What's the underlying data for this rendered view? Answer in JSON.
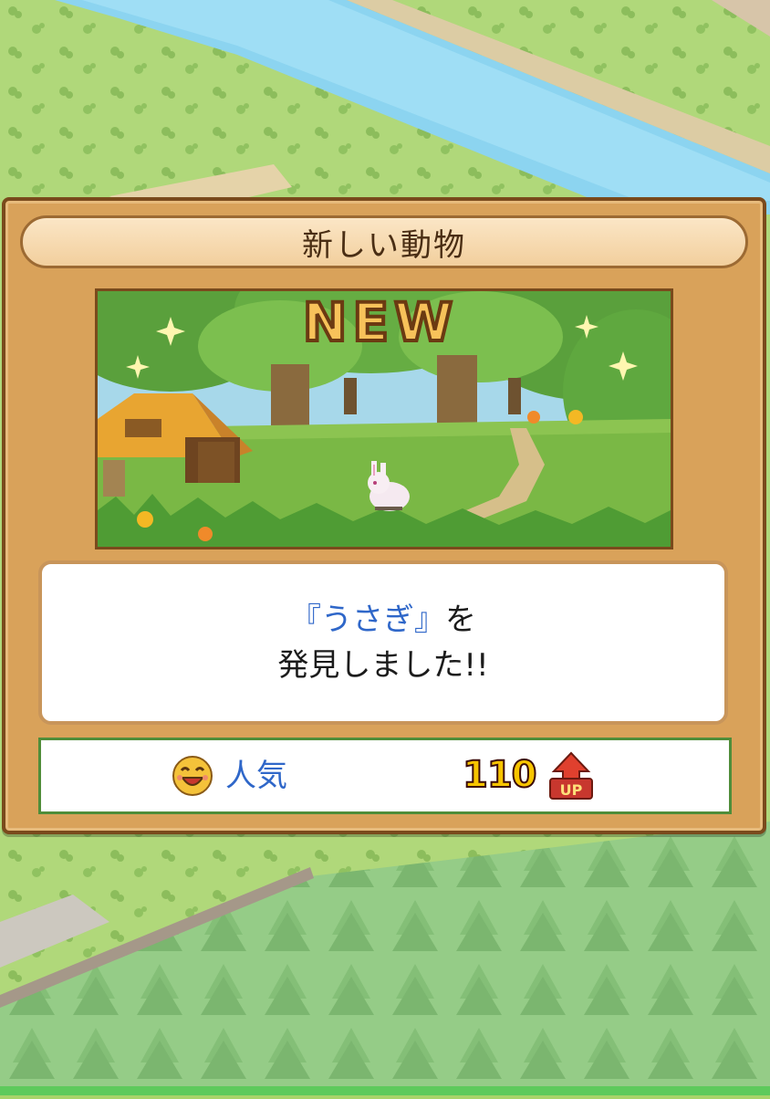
{
  "dialog": {
    "title": "新しい動物",
    "banner_text": "NEW",
    "message": {
      "open_quote": "『",
      "animal_name": "うさぎ",
      "close_quote": "』",
      "particle": "を",
      "line2": "発見しました!!"
    },
    "stat": {
      "icon": "smiley-face-icon",
      "label": "人気",
      "value": "110",
      "badge": "UP"
    }
  },
  "colors": {
    "panel": "#d9a25a",
    "panel_border": "#7a4a1c",
    "title_bar": "#f6d9ad",
    "animal_name": "#2f67c9",
    "stat_label": "#2f67c9",
    "stat_border": "#4f8d3a",
    "value_fill": "#f7c400",
    "value_outline": "#3a0a0a"
  }
}
